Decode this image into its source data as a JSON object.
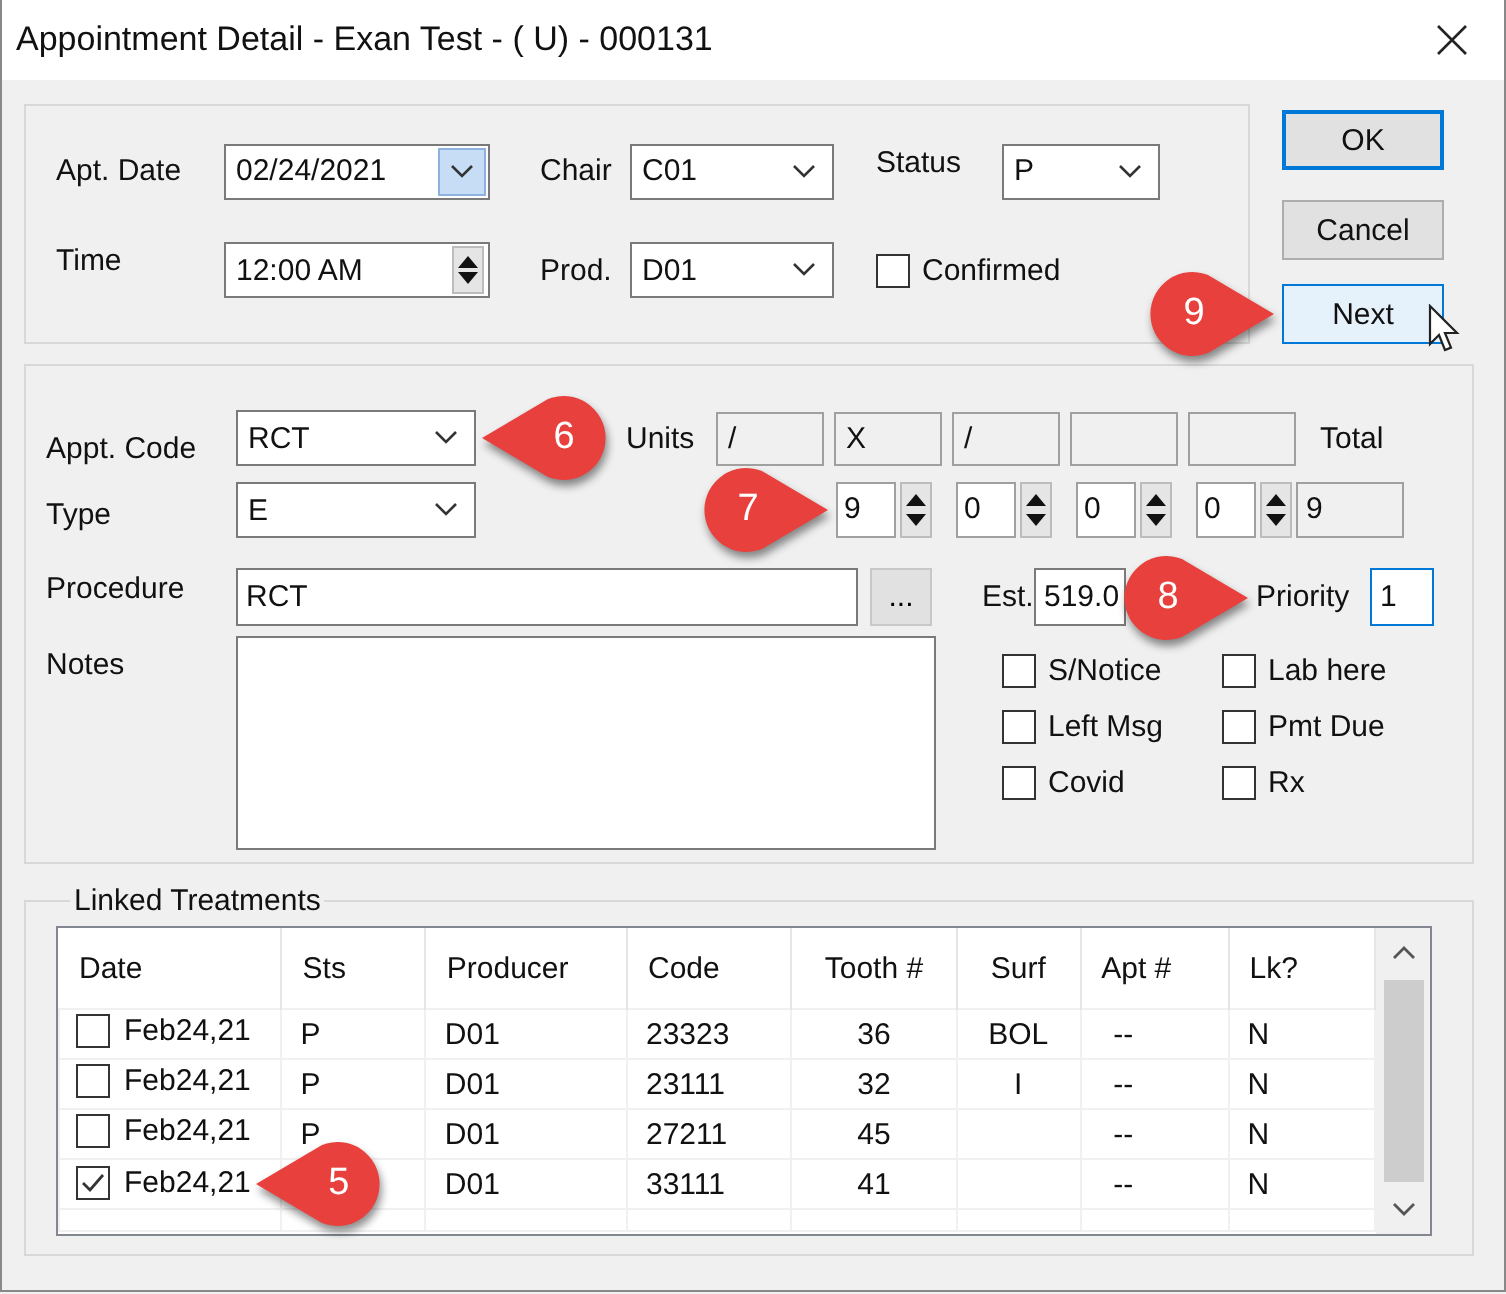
{
  "window": {
    "title": "Appointment Detail - Exan Test - ( U) - 000131"
  },
  "appointment": {
    "apt_date": {
      "label": "Apt. Date",
      "value": "02/24/2021"
    },
    "time": {
      "label": "Time",
      "value": "12:00 AM"
    },
    "chair": {
      "label": "Chair",
      "value": "C01"
    },
    "prod": {
      "label": "Prod.",
      "value": "D01"
    },
    "status": {
      "label": "Status",
      "value": "P"
    },
    "confirmed": {
      "label": "Confirmed",
      "checked": false
    }
  },
  "buttons": [
    {
      "label": "OK",
      "default": true,
      "hovered": false
    },
    {
      "label": "Cancel",
      "default": false,
      "hovered": false
    },
    {
      "label": "Next",
      "default": false,
      "hovered": true,
      "callout": {
        "label": "9",
        "kind": "right"
      }
    }
  ],
  "procedure_panel": {
    "appt_code": {
      "label": "Appt. Code",
      "value": "RCT",
      "callout": {
        "label": "6",
        "kind": "left"
      }
    },
    "type": {
      "label": "Type",
      "value": "E"
    },
    "units_label": "Units",
    "total_label": "Total",
    "units": [
      {
        "code": "/"
      },
      {
        "code": "X",
        "count": "9",
        "callout": {
          "label": "7",
          "kind": "right"
        }
      },
      {
        "code": "/",
        "count": "0"
      },
      {
        "count": "0"
      },
      {
        "count": "0"
      }
    ],
    "total": "9",
    "procedure": {
      "label": "Procedure",
      "value": "RCT",
      "button": "..."
    },
    "est": {
      "label": "Est.",
      "value": "519.0"
    },
    "priority": {
      "label": "Priority",
      "value": "1",
      "focused": true,
      "callout": {
        "label": "8",
        "kind": "right"
      }
    },
    "notes": {
      "label": "Notes"
    },
    "flags": [
      {
        "label": "S/Notice",
        "checked": false
      },
      {
        "label": "Lab here",
        "checked": false
      },
      {
        "label": "Left Msg",
        "checked": false
      },
      {
        "label": "Pmt Due",
        "checked": false
      },
      {
        "label": "Covid",
        "checked": false
      },
      {
        "label": "Rx",
        "checked": false
      }
    ]
  },
  "linked_treatments": {
    "title": "Linked Treatments",
    "columns": [
      "Date",
      "Sts",
      "Producer",
      "Code",
      "Tooth #",
      "Surf",
      "Apt #",
      "Lk?"
    ],
    "rows": [
      {
        "checked": false,
        "date": "Feb24,21",
        "sts": "P",
        "producer": "D01",
        "code": "23323",
        "tooth": "36",
        "surf": "BOL",
        "apt": "--",
        "lk": "N"
      },
      {
        "checked": false,
        "date": "Feb24,21",
        "sts": "P",
        "producer": "D01",
        "code": "23111",
        "tooth": "32",
        "surf": "I",
        "apt": "--",
        "lk": "N"
      },
      {
        "checked": false,
        "date": "Feb24,21",
        "sts": "P",
        "producer": "D01",
        "code": "27211",
        "tooth": "45",
        "apt": "--",
        "lk": "N"
      },
      {
        "checked": true,
        "date": "Feb24,21",
        "producer": "D01",
        "code": "33111",
        "tooth": "41",
        "apt": "--",
        "lk": "N",
        "callout": {
          "label": "5",
          "kind": "left"
        }
      }
    ]
  }
}
